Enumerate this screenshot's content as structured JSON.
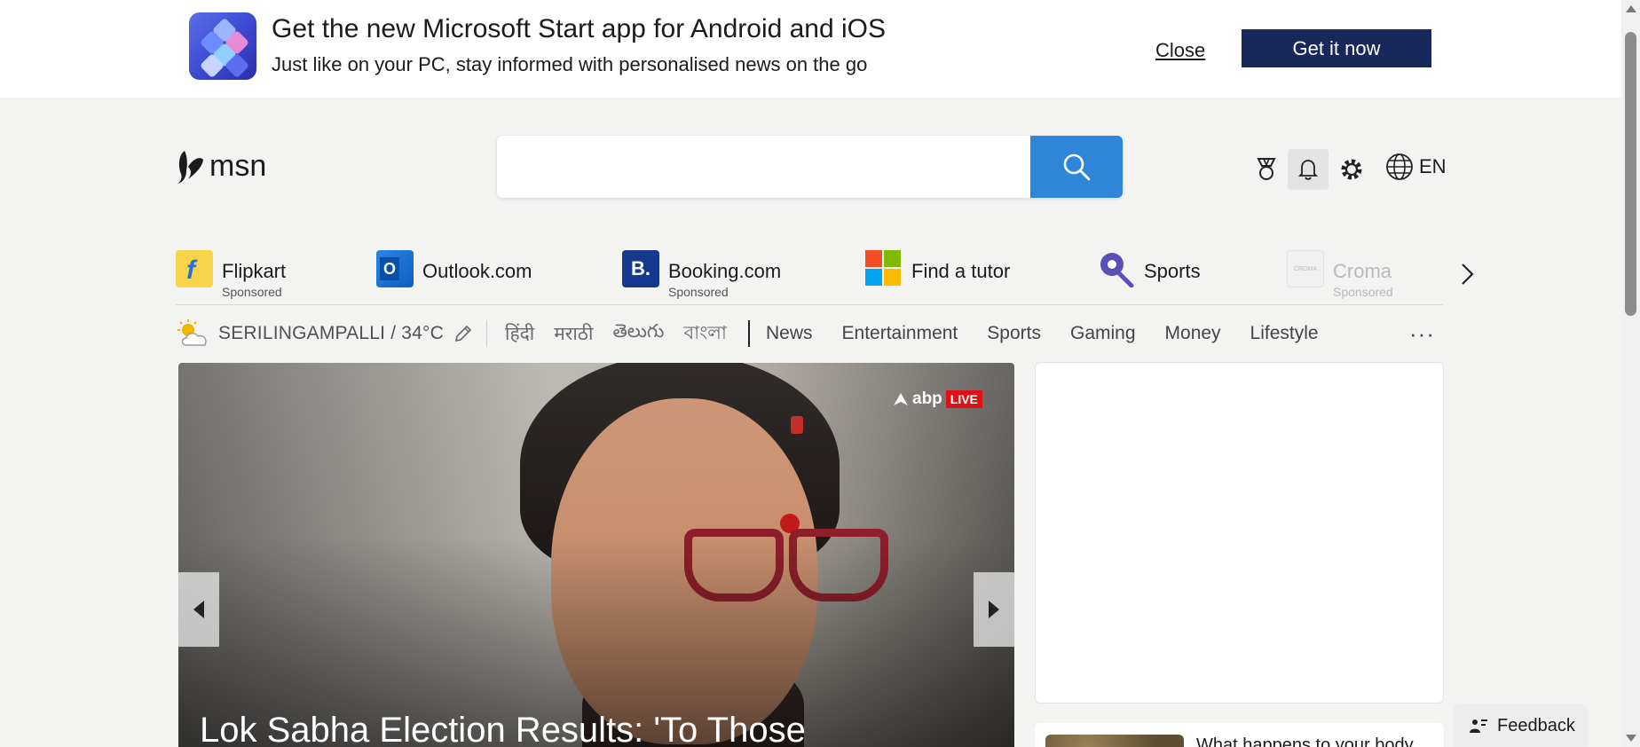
{
  "banner": {
    "title": "Get the new Microsoft Start app for Android and iOS",
    "subtitle": "Just like on your PC, stay informed with personalised news on the go",
    "close_label": "Close",
    "cta_label": "Get it now"
  },
  "header": {
    "logo_text": "msn",
    "search_placeholder": "",
    "language": "EN"
  },
  "quick_links": [
    {
      "label": "Flipkart",
      "sub": "Sponsored",
      "icon": "flipkart-icon"
    },
    {
      "label": "Outlook.com",
      "sub": "",
      "icon": "outlook-icon"
    },
    {
      "label": "Booking.com",
      "sub": "Sponsored",
      "icon": "booking-icon"
    },
    {
      "label": "Find a tutor",
      "sub": "",
      "icon": "tutor-icon"
    },
    {
      "label": "Sports",
      "sub": "",
      "icon": "sports-icon"
    },
    {
      "label": "Croma",
      "sub": "Sponsored",
      "icon": "croma-icon"
    }
  ],
  "nav": {
    "weather": "SERILINGAMPALLI / 34°C",
    "languages": [
      "हिंदी",
      "मराठी",
      "తెలుగు",
      "বাংলা"
    ],
    "items": [
      "News",
      "Entertainment",
      "Sports",
      "Gaming",
      "Money",
      "Lifestyle"
    ],
    "more": "···"
  },
  "hero": {
    "source_badge": "abp",
    "live_badge": "LIVE",
    "title": "Lok Sabha Election Results: 'To Those"
  },
  "side_card": {
    "title": "What happens to your body"
  },
  "feedback_label": "Feedback"
}
